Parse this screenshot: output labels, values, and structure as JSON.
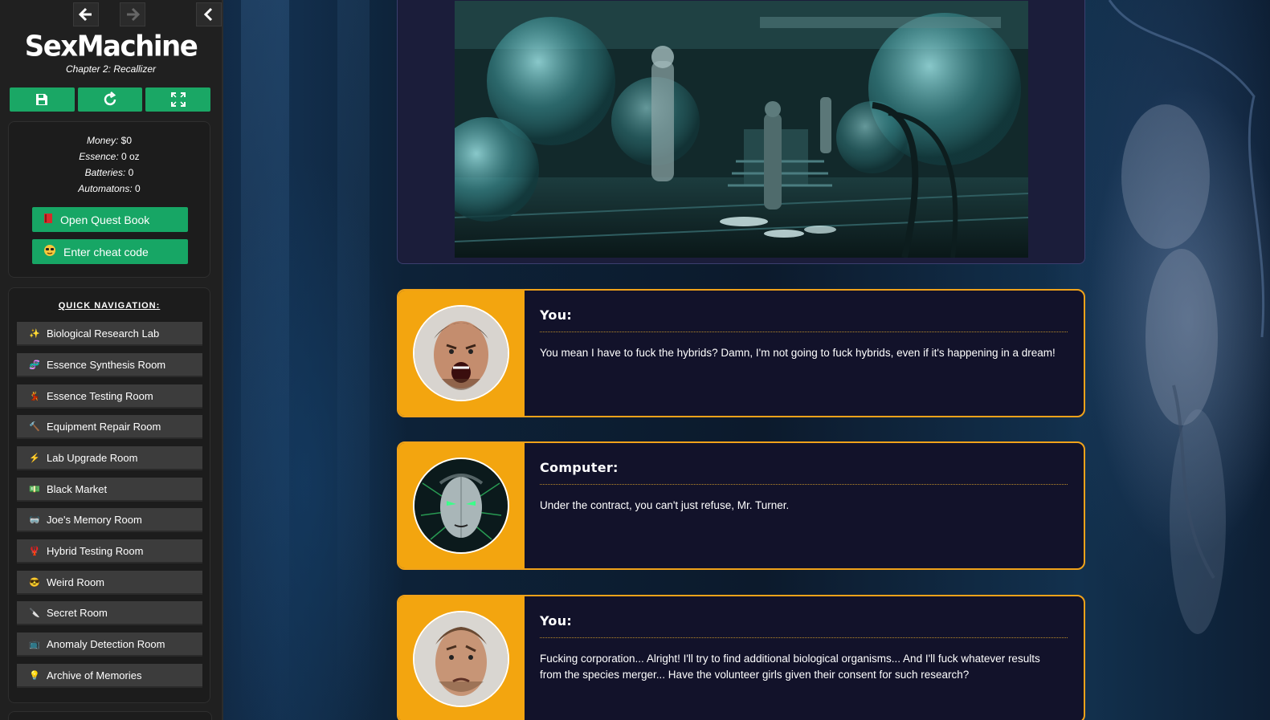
{
  "game": {
    "title": "SexMachine",
    "chapter": "Chapter 2: Recallizer"
  },
  "toolbar": {
    "icons": [
      "save-icon",
      "refresh-icon",
      "fullscreen-icon"
    ]
  },
  "stats": {
    "money_label": "Money:",
    "money_value": "$0",
    "essence_label": "Essence:",
    "essence_value": "0 oz",
    "batteries_label": "Batteries:",
    "batteries_value": "0",
    "automatons_label": "Automatons:",
    "automatons_value": "0"
  },
  "actions": {
    "quest_book": "Open Quest Book",
    "cheat_code": "Enter cheat code"
  },
  "quick_nav": {
    "title": "QUICK NAVIGATION:",
    "items": [
      {
        "label": "Biological Research Lab",
        "icon": "✨"
      },
      {
        "label": "Essence Synthesis Room",
        "icon": "🧬"
      },
      {
        "label": "Essence Testing Room",
        "icon": "💃"
      },
      {
        "label": "Equipment Repair Room",
        "icon": "🔨"
      },
      {
        "label": "Lab Upgrade Room",
        "icon": "⚡"
      },
      {
        "label": "Black Market",
        "icon": "💵"
      },
      {
        "label": "Joe's Memory Room",
        "icon": "🥽"
      },
      {
        "label": "Hybrid Testing Room",
        "icon": "🦞"
      },
      {
        "label": "Weird Room",
        "icon": "😎"
      },
      {
        "label": "Secret Room",
        "icon": "🔪"
      },
      {
        "label": "Anomaly Detection Room",
        "icon": "📺"
      },
      {
        "label": "Archive of Memories",
        "icon": "💡"
      }
    ]
  },
  "dialogue": [
    {
      "speaker": "You:",
      "text": "You mean I have to fuck the hybrids? Damn, I'm not going to fuck hybrids, even if it's happening in a dream!"
    },
    {
      "speaker": "Computer:",
      "text": "Under the contract, you can't just refuse, Mr. Turner."
    },
    {
      "speaker": "You:",
      "text": "Fucking corporation... Alright! I'll try to find additional biological organisms... And I'll fuck whatever results from the species merger... Have the volunteer girls given their consent for such research?"
    }
  ],
  "colors": {
    "sidebar_bg": "#202020",
    "green_button": "#17a665",
    "dialog_accent": "#f3a50f",
    "dialog_bg": "#12122a"
  }
}
